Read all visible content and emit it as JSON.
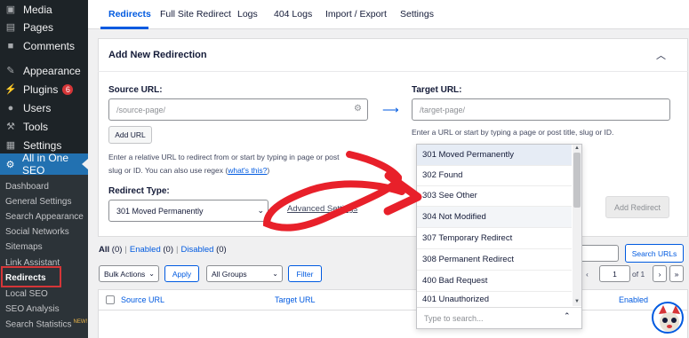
{
  "sidebar": {
    "items": [
      {
        "label": "Media",
        "icon": "media-icon"
      },
      {
        "label": "Pages",
        "icon": "pages-icon"
      },
      {
        "label": "Comments",
        "icon": "comments-icon"
      },
      {
        "label": "Appearance",
        "icon": "appearance-icon"
      },
      {
        "label": "Plugins",
        "icon": "plugins-icon",
        "badge": "6"
      },
      {
        "label": "Users",
        "icon": "users-icon"
      },
      {
        "label": "Tools",
        "icon": "tools-icon"
      },
      {
        "label": "Settings",
        "icon": "settings-icon"
      },
      {
        "label": "All in One SEO",
        "icon": "aioseo-icon"
      }
    ],
    "submenu": [
      {
        "label": "Dashboard"
      },
      {
        "label": "General Settings"
      },
      {
        "label": "Search Appearance"
      },
      {
        "label": "Social Networks"
      },
      {
        "label": "Sitemaps"
      },
      {
        "label": "Link Assistant"
      },
      {
        "label": "Redirects"
      },
      {
        "label": "Local SEO"
      },
      {
        "label": "SEO Analysis"
      },
      {
        "label": "Search Statistics",
        "new": "NEW!"
      }
    ]
  },
  "tabs": [
    "Redirects",
    "Full Site Redirect",
    "Logs",
    "404 Logs",
    "Import / Export",
    "Settings"
  ],
  "card": {
    "title": "Add New Redirection",
    "source_label": "Source URL:",
    "source_placeholder": "/source-page/",
    "add_url": "Add URL",
    "source_help": "Enter a relative URL to redirect from or start by typing in page or post",
    "source_help2": "slug or ID. You can also use regex (",
    "source_help_link": "what's this?",
    "source_help_end": ")",
    "target_label": "Target URL:",
    "target_placeholder": "/target-page/",
    "target_help": "Enter a URL or start by typing a page or post title, slug or ID.",
    "redirect_type_label": "Redirect Type:",
    "redirect_type_value": "301 Moved Permanently",
    "advanced_settings": "Advanced Settings",
    "add_redirect": "Add Redirect"
  },
  "dropdown": {
    "options": [
      "301 Moved Permanently",
      "302 Found",
      "303 See Other",
      "304 Not Modified",
      "307 Temporary Redirect",
      "308 Permanent Redirect",
      "400 Bad Request",
      "401 Unauthorized"
    ],
    "search_placeholder": "Type to search..."
  },
  "filters": {
    "all": "All",
    "all_count": "(0)",
    "enabled": "Enabled",
    "enabled_count": "(0)",
    "disabled": "Disabled",
    "disabled_count": "(0)",
    "bulk_actions": "Bulk Actions",
    "apply": "Apply",
    "all_groups": "All Groups",
    "filter": "Filter",
    "search_urls": "Search URLs",
    "page": "1",
    "of": "of 1"
  },
  "table": {
    "source_url": "Source URL",
    "target_url": "Target URL",
    "enabled": "Enabled"
  },
  "colors": {
    "accent": "#005ae0",
    "sidebar": "#1d2327",
    "active_menu": "#2271b1",
    "annotation": "#e8202a"
  }
}
